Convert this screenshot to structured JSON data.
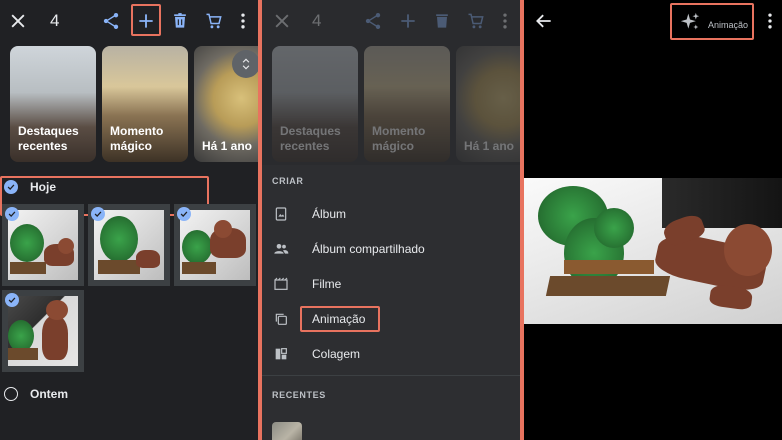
{
  "panel1": {
    "selection_count": "4",
    "memories": [
      {
        "label": "Destaques recentes"
      },
      {
        "label": "Momento mágico"
      },
      {
        "label": "Há 1 ano"
      }
    ],
    "sections": {
      "today": "Hoje",
      "yesterday": "Ontem"
    },
    "icons": {
      "close": "close-icon",
      "share": "share-icon",
      "add": "add-icon",
      "delete": "trash-icon",
      "cart": "cart-icon",
      "more": "more-vert-icon"
    }
  },
  "panel2": {
    "selection_count": "4",
    "memories": [
      {
        "label": "Destaques recentes"
      },
      {
        "label": "Momento mágico"
      },
      {
        "label": "Há 1 ano"
      }
    ],
    "create_header": "CRIAR",
    "menu": [
      {
        "label": "Álbum",
        "icon": "album-icon"
      },
      {
        "label": "Álbum compartilhado",
        "icon": "shared-album-icon"
      },
      {
        "label": "Filme",
        "icon": "movie-icon"
      },
      {
        "label": "Animação",
        "icon": "animation-icon"
      },
      {
        "label": "Colagem",
        "icon": "collage-icon"
      }
    ],
    "recent_header": "RECENTES"
  },
  "panel3": {
    "animation_label": "Animação",
    "icons": {
      "back": "back-arrow-icon",
      "sparkle": "sparkle-icon",
      "more": "more-vert-icon"
    }
  },
  "colors": {
    "highlight": "#e8735f",
    "accent": "#8ab4f8",
    "panel_bg": "#202124"
  }
}
